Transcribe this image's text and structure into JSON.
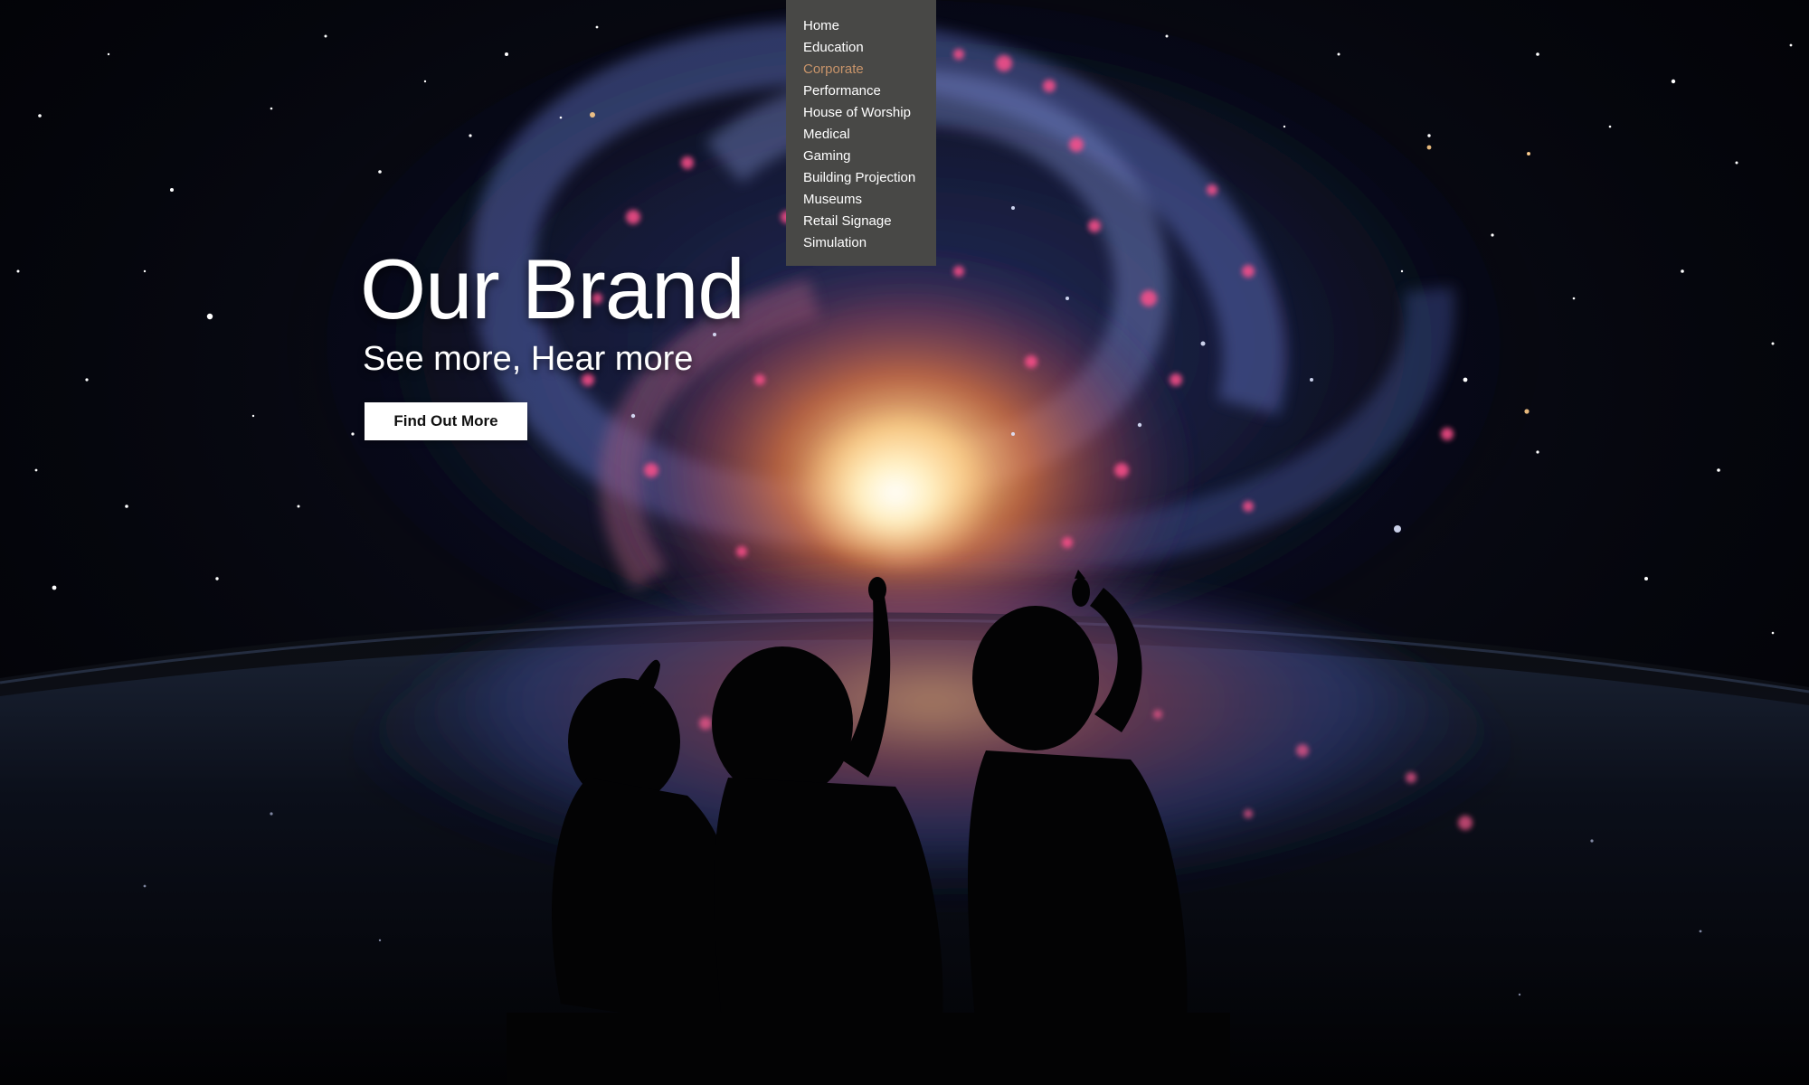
{
  "colors": {
    "background": "#010104",
    "menu_background": "#484846",
    "menu_text": "#ffffff",
    "menu_active": "#c8946a",
    "hero_text": "#ffffff",
    "button_background": "#ffffff",
    "button_text": "#111111",
    "galaxy_core": "#ffd9a0",
    "galaxy_warm": "#e06a3a",
    "galaxy_pink": "#ff4f8b",
    "galaxy_blue": "#5d73c9"
  },
  "nav": {
    "items": [
      {
        "label": "Home",
        "active": false
      },
      {
        "label": "Education",
        "active": false
      },
      {
        "label": "Corporate",
        "active": true
      },
      {
        "label": "Performance",
        "active": false
      },
      {
        "label": "House of Worship",
        "active": false
      },
      {
        "label": "Medical",
        "active": false
      },
      {
        "label": "Gaming",
        "active": false
      },
      {
        "label": "Building Projection",
        "active": false
      },
      {
        "label": "Museums",
        "active": false
      },
      {
        "label": "Retail Signage",
        "active": false
      },
      {
        "label": "Simulation",
        "active": false
      }
    ]
  },
  "hero": {
    "title": "Our Brand",
    "subtitle": "See more, Hear more",
    "cta_label": "Find Out More"
  },
  "background": {
    "image_description_icon": "galaxy-planetarium-image"
  }
}
